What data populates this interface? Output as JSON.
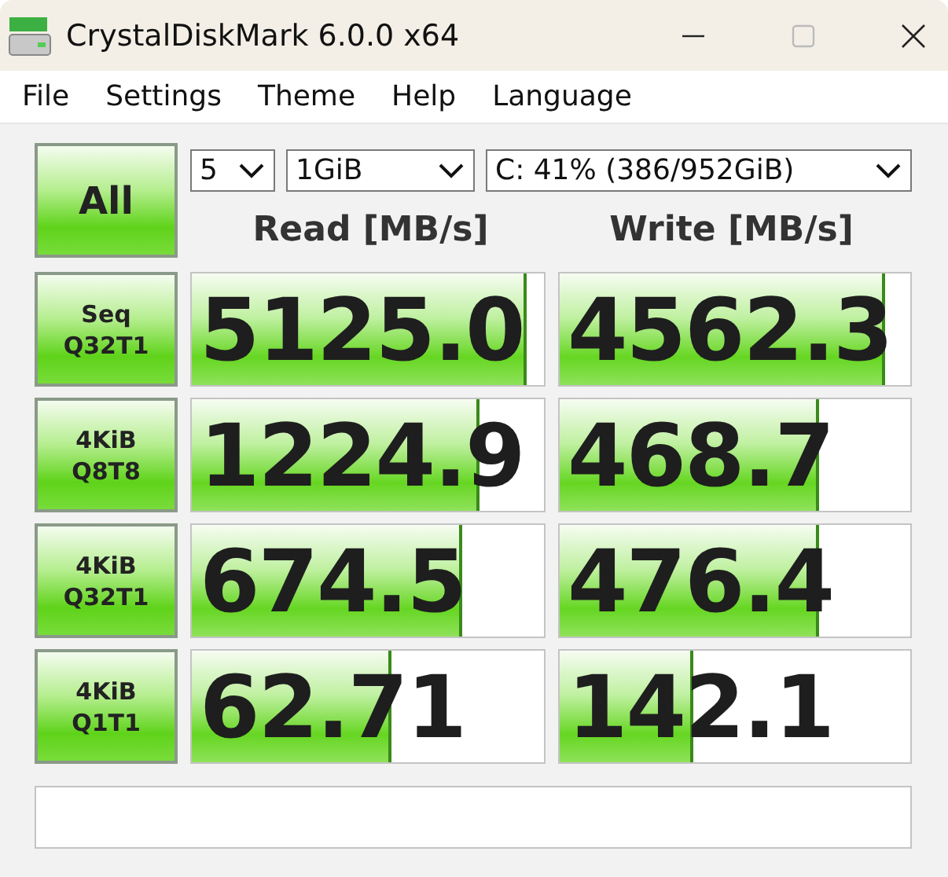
{
  "window": {
    "title": "CrystalDiskMark 6.0.0 x64"
  },
  "menu": [
    "File",
    "Settings",
    "Theme",
    "Help",
    "Language"
  ],
  "all_button": "All",
  "selects": [
    {
      "value": "5"
    },
    {
      "value": "1GiB"
    },
    {
      "value": "C: 41% (386/952GiB)"
    }
  ],
  "columns": [
    "Read [MB/s]",
    "Write [MB/s]"
  ],
  "rows": [
    {
      "label": [
        "Seq",
        "Q32T1"
      ],
      "read": {
        "value": "5125.0",
        "level": 0.94
      },
      "write": {
        "value": "4562.3",
        "level": 0.92
      }
    },
    {
      "label": [
        "4KiB",
        "Q8T8"
      ],
      "read": {
        "value": "1224.9",
        "level": 0.81
      },
      "write": {
        "value": "468.7",
        "level": 0.73
      }
    },
    {
      "label": [
        "4KiB",
        "Q32T1"
      ],
      "read": {
        "value": "674.5",
        "level": 0.76
      },
      "write": {
        "value": "476.4",
        "level": 0.73
      }
    },
    {
      "label": [
        "4KiB",
        "Q1T1"
      ],
      "read": {
        "value": "62.71",
        "level": 0.56
      },
      "write": {
        "value": "142.1",
        "level": 0.37
      }
    }
  ]
}
